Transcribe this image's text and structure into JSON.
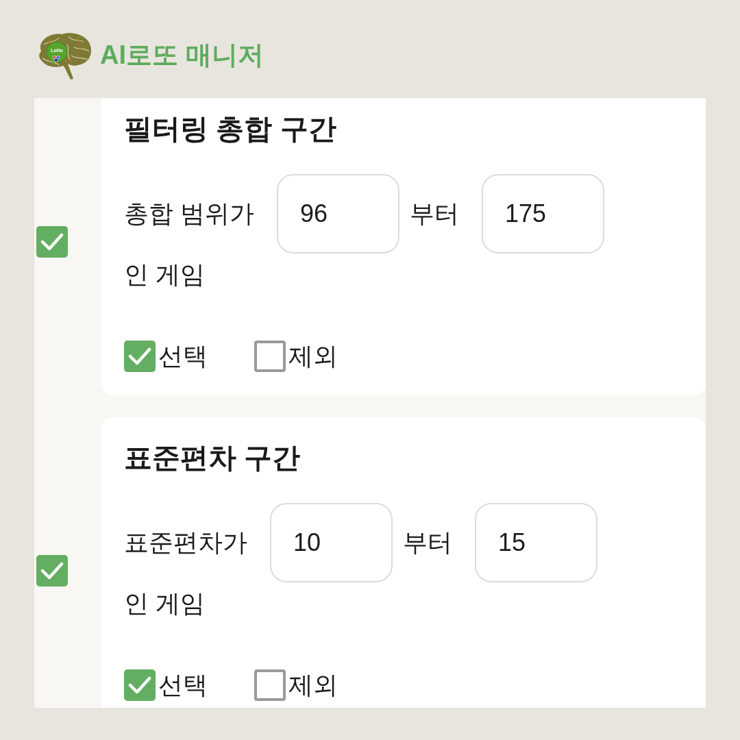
{
  "header": {
    "logo_text": "Lotto",
    "title": "AI로또 매니저"
  },
  "filters": [
    {
      "enabled": true,
      "title": "필터링 총합 구간",
      "label": "총합 범위가",
      "from": "96",
      "connector": "부터",
      "to": "175",
      "suffix": "인 게임",
      "options": [
        {
          "label": "선택",
          "checked": true
        },
        {
          "label": "제외",
          "checked": false
        }
      ]
    },
    {
      "enabled": true,
      "title": "표준편차 구간",
      "label": "표준편차가",
      "from": "10",
      "connector": "부터",
      "to": "15",
      "suffix": "인 게임",
      "options": [
        {
          "label": "선택",
          "checked": true
        },
        {
          "label": "제외",
          "checked": false
        }
      ]
    }
  ]
}
